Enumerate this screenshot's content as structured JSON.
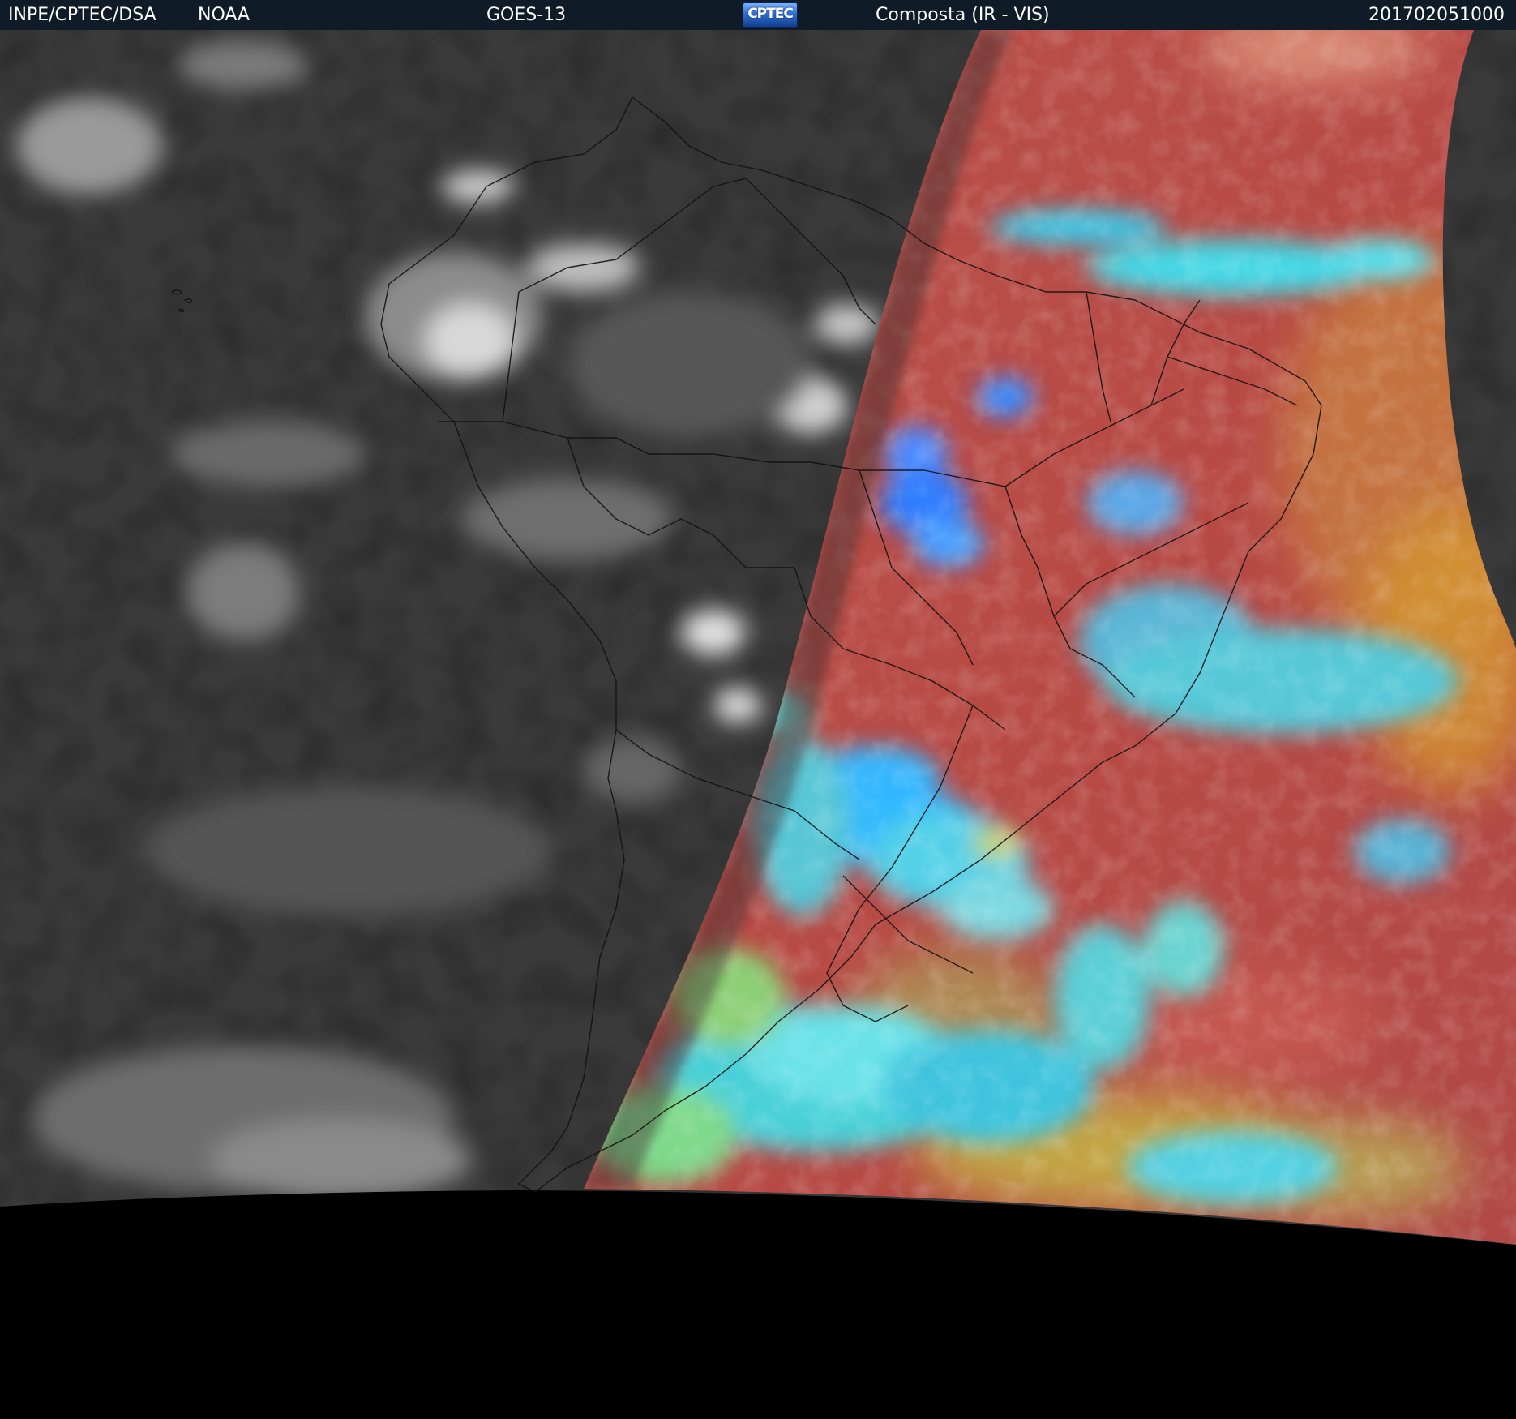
{
  "header": {
    "organization": "INPE/CPTEC/DSA",
    "source": "NOAA",
    "satellite": "GOES-13",
    "logo_text": "CPTEC",
    "product": "Composta (IR - VIS)",
    "timestamp": "201702051000"
  },
  "colors": {
    "header_bg": "#0f1b26",
    "night_ir_gray": "#3a3a3a",
    "day_composite_red": "#b84a45",
    "cloud_cyan": "#44d8e6",
    "cloud_blue": "#3b8cff",
    "space_black": "#000000"
  }
}
